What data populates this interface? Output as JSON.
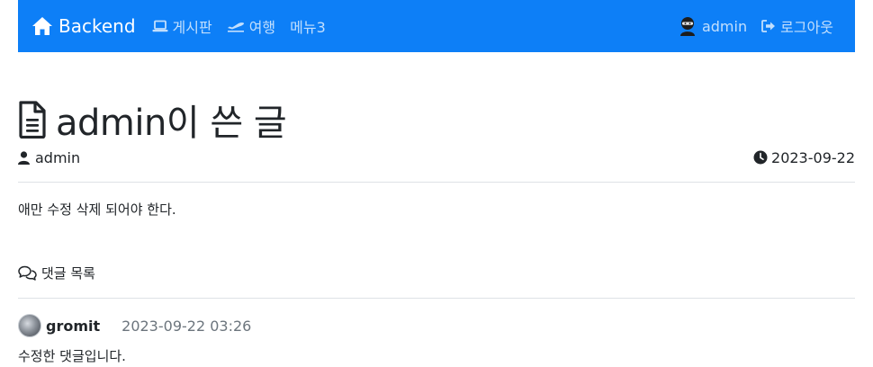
{
  "nav": {
    "brand": "Backend",
    "items": [
      {
        "label": "게시판",
        "icon": "laptop-icon"
      },
      {
        "label": "여행",
        "icon": "plane-icon"
      },
      {
        "label": "메뉴3",
        "icon": ""
      }
    ],
    "user": "admin",
    "logout": "로그아웃",
    "bg_color": "#0d7ff7"
  },
  "post": {
    "title": "admin이 쓴 글",
    "author": "admin",
    "date": "2023-09-22",
    "content": "애만 수정 삭제 되어야 한다."
  },
  "comments": {
    "heading": "댓글 목록",
    "items": [
      {
        "user": "gromit",
        "time": "2023-09-22 03:26",
        "body": "수정한 댓글입니다."
      }
    ]
  }
}
